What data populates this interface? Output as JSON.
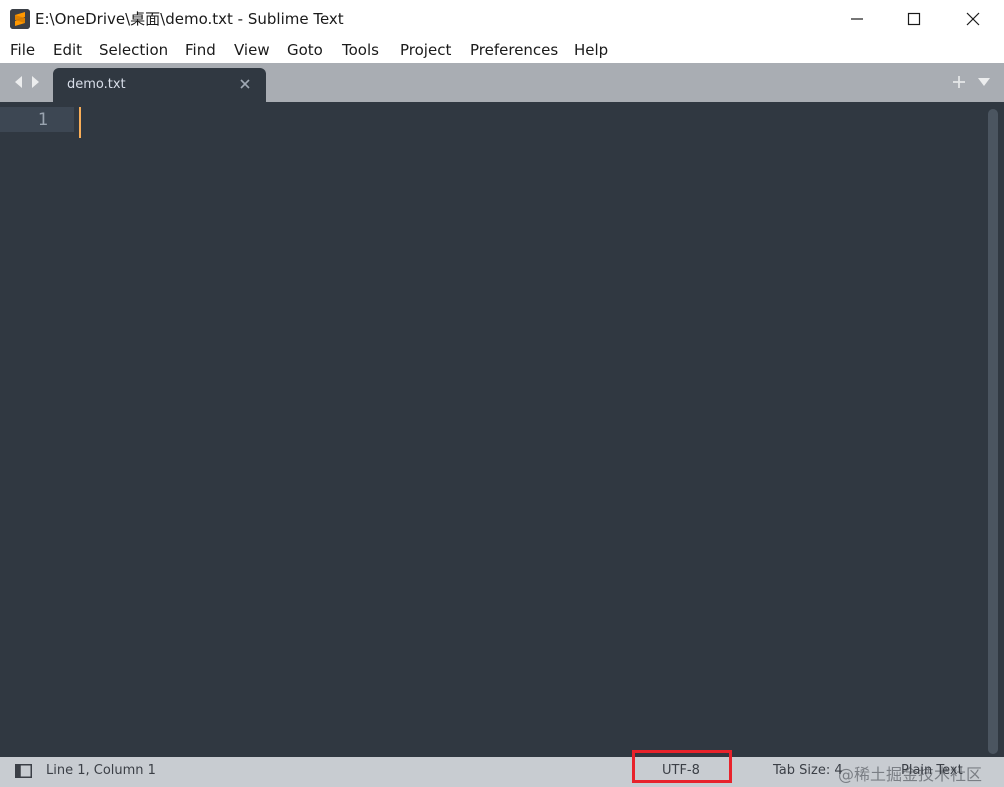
{
  "window": {
    "title": "E:\\OneDrive\\桌面\\demo.txt - Sublime Text",
    "app_icon": "sublime-text-icon",
    "controls": [
      "minimize-icon",
      "maximize-icon",
      "close-icon"
    ]
  },
  "menubar": {
    "items": [
      {
        "label": "File"
      },
      {
        "label": "Edit"
      },
      {
        "label": "Selection"
      },
      {
        "label": "Find"
      },
      {
        "label": "View"
      },
      {
        "label": "Goto"
      },
      {
        "label": "Tools"
      },
      {
        "label": "Project"
      },
      {
        "label": "Preferences"
      },
      {
        "label": "Help"
      }
    ]
  },
  "tabs": {
    "active": {
      "label": "demo.txt"
    },
    "nav_icons": [
      "arrow-left-icon",
      "arrow-right-icon"
    ],
    "extra_icons": [
      "plus-icon",
      "chevron-down-icon"
    ]
  },
  "editor": {
    "line_numbers": [
      "1"
    ],
    "content": "",
    "colors": {
      "background": "#303841",
      "caret": "#f9ae58",
      "gutter_active": "#3d4753"
    }
  },
  "statusbar": {
    "position": "Line 1, Column 1",
    "encoding": "UTF-8",
    "tab_size": "Tab Size: 4",
    "syntax": "Plain Text",
    "highlight_color": "#e8222b"
  },
  "watermark": {
    "text": "@稀土掘金技术社区"
  }
}
